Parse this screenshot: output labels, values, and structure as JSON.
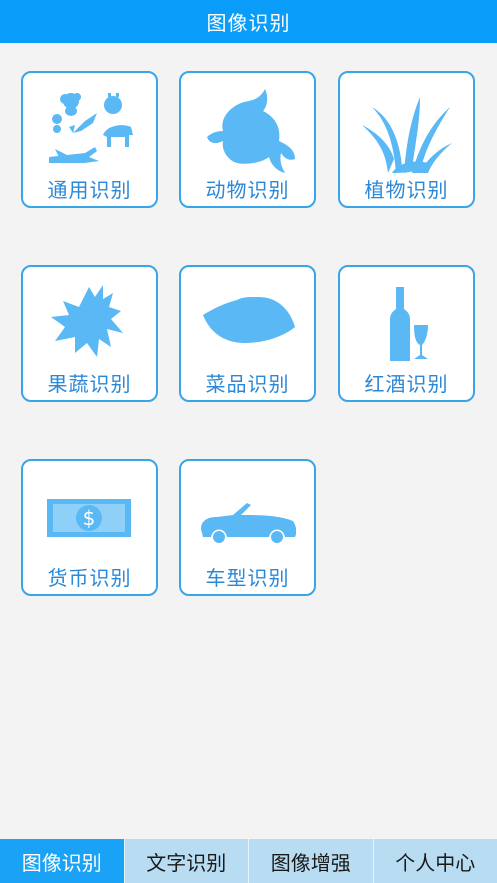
{
  "header": {
    "title": "图像识别"
  },
  "cards": [
    {
      "label": "通用识别",
      "icon": "general-objects-icon"
    },
    {
      "label": "动物识别",
      "icon": "goldfish-icon"
    },
    {
      "label": "植物识别",
      "icon": "grass-plant-icon"
    },
    {
      "label": "果蔬识别",
      "icon": "fruit-vegetable-icon"
    },
    {
      "label": "菜品识别",
      "icon": "dish-icon"
    },
    {
      "label": "红酒识别",
      "icon": "wine-bottle-glass-icon"
    },
    {
      "label": "货币识别",
      "icon": "dollar-bill-icon"
    },
    {
      "label": "车型识别",
      "icon": "convertible-car-icon"
    }
  ],
  "tabs": [
    {
      "label": "图像识别",
      "active": true
    },
    {
      "label": "文字识别",
      "active": false
    },
    {
      "label": "图像增强",
      "active": false
    },
    {
      "label": "个人中心",
      "active": false
    }
  ],
  "colors": {
    "primary": "#0a9cf9",
    "icon_fill": "#5ab8f5",
    "card_border": "#3aa4e8",
    "label_text": "#2a88d8",
    "tab_active": "#1aa3f6",
    "tab_bar": "#b8ddf3",
    "background": "#f3f3f3"
  }
}
